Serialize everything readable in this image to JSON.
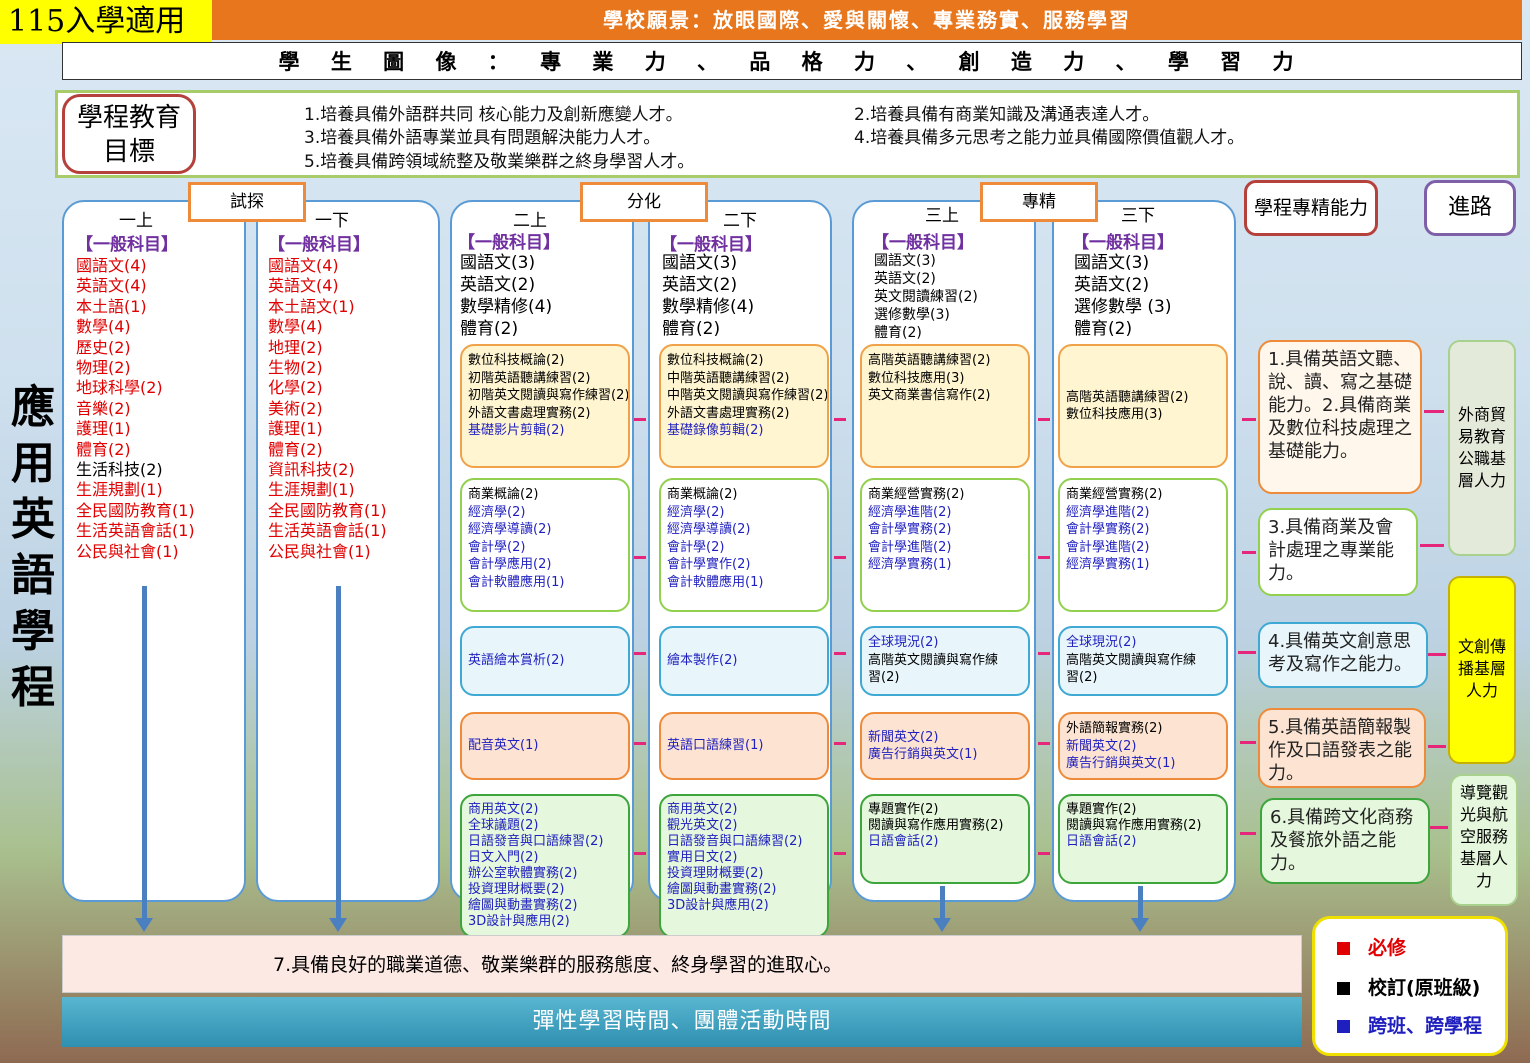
{
  "badge": "115入學適用",
  "vision": "學校願景：放眼國際、愛與關懷、專業務實、服務學習",
  "portrait": "學 生 圖 像 ： 專 業 力 、 品 格 力 、 創 造 力 、 學 習 力",
  "goal_label": "學程教育目標",
  "goals": [
    "1.培養具備外語群共同 核心能力及創新應變人才。",
    "2.培養具備有商業知識及溝通表達人才。",
    "3.培養具備外語專業並具有問題解決能力人才。",
    "4.培養具備多元思考之能力並具備國際價值觀人才。",
    "5.培養具備跨領域統整及敬業樂群之終身學習人才。"
  ],
  "program_title": "應用英語學程",
  "stages": [
    "試探",
    "分化",
    "專精"
  ],
  "general_label": "【一般科目】",
  "semesters": [
    {
      "name": "一上",
      "courses": [
        {
          "t": "國語文(4)",
          "c": "red"
        },
        {
          "t": "英語文(4)",
          "c": "red"
        },
        {
          "t": "本土語(1)",
          "c": "red"
        },
        {
          "t": "數學(4)",
          "c": "red"
        },
        {
          "t": "歷史(2)",
          "c": "red"
        },
        {
          "t": "物理(2)",
          "c": "red"
        },
        {
          "t": "地球科學(2)",
          "c": "red"
        },
        {
          "t": "音樂(2)",
          "c": "red"
        },
        {
          "t": "護理(1)",
          "c": "red"
        },
        {
          "t": "體育(2)",
          "c": "red"
        },
        {
          "t": "生活科技(2)",
          "c": "blk"
        },
        {
          "t": "生涯規劃(1)",
          "c": "red"
        },
        {
          "t": "全民國防教育(1)",
          "c": "red"
        },
        {
          "t": "生活英語會話(1)",
          "c": "red"
        },
        {
          "t": "公民與社會(1)",
          "c": "red"
        }
      ]
    },
    {
      "name": "一下",
      "courses": [
        {
          "t": "國語文(4)",
          "c": "red"
        },
        {
          "t": "英語文(4)",
          "c": "red"
        },
        {
          "t": "本土語文(1)",
          "c": "red"
        },
        {
          "t": "數學(4)",
          "c": "red"
        },
        {
          "t": "地理(2)",
          "c": "red"
        },
        {
          "t": "生物(2)",
          "c": "red"
        },
        {
          "t": "化學(2)",
          "c": "red"
        },
        {
          "t": "美術(2)",
          "c": "red"
        },
        {
          "t": "護理(1)",
          "c": "red"
        },
        {
          "t": "體育(2)",
          "c": "red"
        },
        {
          "t": "資訊科技(2)",
          "c": "red"
        },
        {
          "t": "生涯規劃(1)",
          "c": "red"
        },
        {
          "t": "全民國防教育(1)",
          "c": "red"
        },
        {
          "t": "生活英語會話(1)",
          "c": "red"
        },
        {
          "t": "公民與社會(1)",
          "c": "red"
        }
      ]
    },
    {
      "name": "二上",
      "general": [
        "國語文(3)",
        "英語文(2)",
        "數學精修(4)",
        "體育(2)"
      ],
      "boxes": [
        [
          {
            "t": "數位科技概論(2)",
            "c": "blk"
          },
          {
            "t": "初階英語聽講練習(2)",
            "c": "blk"
          },
          {
            "t": "初階英文閱讀與寫作練習(2)",
            "c": "blk"
          },
          {
            "t": "外語文書處理實務(2)",
            "c": "blk"
          },
          {
            "t": "基礎影片剪輯(2)",
            "c": "blu"
          }
        ],
        [
          {
            "t": "商業概論(2)",
            "c": "blk"
          },
          {
            "t": "經濟學(2)",
            "c": "blu"
          },
          {
            "t": "經濟學導讀(2)",
            "c": "blu"
          },
          {
            "t": "會計學(2)",
            "c": "blu"
          },
          {
            "t": "會計學應用(2)",
            "c": "blu"
          },
          {
            "t": "會計軟體應用(1)",
            "c": "blu"
          }
        ],
        [
          {
            "t": "英語繪本賞析(2)",
            "c": "blu"
          }
        ],
        [
          {
            "t": "配音英文(1)",
            "c": "blu"
          }
        ],
        [
          {
            "t": "商用英文(2)",
            "c": "blu"
          },
          {
            "t": "全球議題(2)",
            "c": "blu"
          },
          {
            "t": "日語發音與口語練習(2)",
            "c": "blu"
          },
          {
            "t": "日文入門(2)",
            "c": "blu"
          },
          {
            "t": "辦公室軟體實務(2)",
            "c": "blu"
          },
          {
            "t": "投資理財概要(2)",
            "c": "blu"
          },
          {
            "t": "繪圖與動畫實務(2)",
            "c": "blu"
          },
          {
            "t": "3D設計與應用(2)",
            "c": "blu"
          }
        ]
      ]
    },
    {
      "name": "二下",
      "general": [
        "國語文(3)",
        "英語文(2)",
        "數學精修(4)",
        "體育(2)"
      ],
      "boxes": [
        [
          {
            "t": "數位科技概論(2)",
            "c": "blk"
          },
          {
            "t": "中階英語聽講練習(2)",
            "c": "blk"
          },
          {
            "t": "中階英文閱讀與寫作練習(2)",
            "c": "blk"
          },
          {
            "t": "外語文書處理實務(2)",
            "c": "blk"
          },
          {
            "t": "基礎錄像剪輯(2)",
            "c": "blu"
          }
        ],
        [
          {
            "t": "商業概論(2)",
            "c": "blk"
          },
          {
            "t": "經濟學(2)",
            "c": "blu"
          },
          {
            "t": "經濟學導讀(2)",
            "c": "blu"
          },
          {
            "t": "會計學(2)",
            "c": "blu"
          },
          {
            "t": "會計學實作(2)",
            "c": "blu"
          },
          {
            "t": "會計軟體應用(1)",
            "c": "blu"
          }
        ],
        [
          {
            "t": "繪本製作(2)",
            "c": "blu"
          }
        ],
        [
          {
            "t": "英語口語練習(1)",
            "c": "blu"
          }
        ],
        [
          {
            "t": "商用英文(2)",
            "c": "blu"
          },
          {
            "t": "觀光英文(2)",
            "c": "blu"
          },
          {
            "t": "日語發音與口語練習(2)",
            "c": "blu"
          },
          {
            "t": "實用日文(2)",
            "c": "blu"
          },
          {
            "t": "投資理財概要(2)",
            "c": "blu"
          },
          {
            "t": "繪圖與動畫實務(2)",
            "c": "blu"
          },
          {
            "t": "3D設計與應用(2)",
            "c": "blu"
          }
        ]
      ]
    },
    {
      "name": "三上",
      "general": [
        "國語文(3)",
        "英語文(2)",
        "英文閱讀練習(2)",
        "選修數學(3)",
        "體育(2)"
      ],
      "boxes": [
        [
          {
            "t": "高階英語聽講練習(2)",
            "c": "blk"
          },
          {
            "t": "數位科技應用(3)",
            "c": "blk"
          },
          {
            "t": "英文商業書信寫作(2)",
            "c": "blk"
          }
        ],
        [
          {
            "t": "商業經營實務(2)",
            "c": "blk"
          },
          {
            "t": "經濟學進階(2)",
            "c": "blu"
          },
          {
            "t": "會計學實務(2)",
            "c": "blu"
          },
          {
            "t": "會計學進階(2)",
            "c": "blu"
          },
          {
            "t": "經濟學實務(1)",
            "c": "blu"
          }
        ],
        [
          {
            "t": "全球現況(2)",
            "c": "blu"
          },
          {
            "t": "高階英文閱讀與寫作練",
            "c": "blk"
          },
          {
            "t": "習(2)",
            "c": "blk"
          }
        ],
        [
          {
            "t": "新聞英文(2)",
            "c": "blu"
          },
          {
            "t": "廣告行銷與英文(1)",
            "c": "blu"
          }
        ],
        [
          {
            "t": "專題實作(2)",
            "c": "blk"
          },
          {
            "t": "閱讀與寫作應用實務(2)",
            "c": "blk"
          },
          {
            "t": "日語會話(2)",
            "c": "blu"
          }
        ]
      ]
    },
    {
      "name": "三下",
      "general": [
        "國語文(3)",
        "英語文(2)",
        "選修數學 (3)",
        "體育(2)"
      ],
      "boxes": [
        [
          {
            "t": "高階英語聽講練習(2)",
            "c": "blk"
          },
          {
            "t": "數位科技應用(3)",
            "c": "blk"
          }
        ],
        [
          {
            "t": "商業經營實務(2)",
            "c": "blk"
          },
          {
            "t": "經濟學進階(2)",
            "c": "blu"
          },
          {
            "t": "會計學實務(2)",
            "c": "blu"
          },
          {
            "t": "會計學進階(2)",
            "c": "blu"
          },
          {
            "t": "經濟學實務(1)",
            "c": "blu"
          }
        ],
        [
          {
            "t": "全球現況(2)",
            "c": "blu"
          },
          {
            "t": "高階英文閱讀與寫作練",
            "c": "blk"
          },
          {
            "t": "習(2)",
            "c": "blk"
          }
        ],
        [
          {
            "t": "外語簡報實務(2)",
            "c": "blk"
          },
          {
            "t": "新聞英文(2)",
            "c": "blu"
          },
          {
            "t": "廣告行銷與英文(1)",
            "c": "blu"
          }
        ],
        [
          {
            "t": "專題實作(2)",
            "c": "blk"
          },
          {
            "t": "閱讀與寫作應用實務(2)",
            "c": "blk"
          },
          {
            "t": "日語會話(2)",
            "c": "blu"
          }
        ]
      ]
    }
  ],
  "competency_header": "學程專精能力",
  "pathway_header": "進路",
  "competencies": [
    "1.具備英語文聽、說、讀、寫之基礎能力。2.具備商業及數位科技處理之基礎能力。",
    "3.具備商業及會計處理之專業能力。",
    "4.具備英文創意思考及寫作之能力。",
    "5.具備英語簡報製作及口語發表之能力。",
    "6.具備跨文化商務及餐旅外語之能力。"
  ],
  "pathways": [
    "外商貿易教育公職基層人力",
    "文創傳播基層人力",
    "導覽觀光與航空服務基層人力"
  ],
  "general_competency": "7.具備良好的職業道德、敬業樂群的服務態度、終身學習的進取心。",
  "flex_time": "彈性學習時間、團體活動時間",
  "legend": [
    {
      "label": "必修",
      "color": "#e00000"
    },
    {
      "label": "校訂(原班級)",
      "color": "#000000"
    },
    {
      "label": "跨班、跨學程",
      "color": "#1f1fbf"
    }
  ],
  "colors": {
    "required": "#e00000",
    "school": "#000000",
    "cross": "#1f1fbf",
    "accent": "#e6267a"
  }
}
